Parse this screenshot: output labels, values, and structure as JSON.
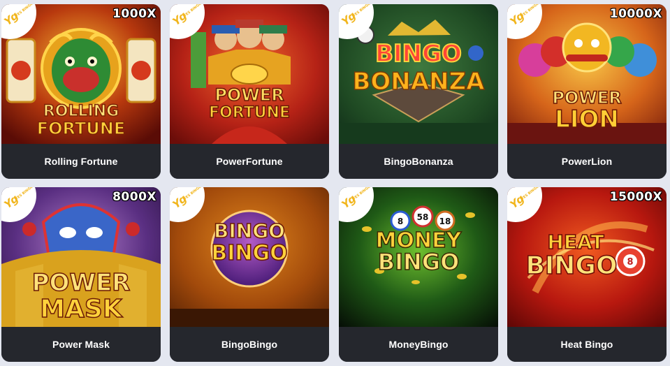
{
  "provider_badge": {
    "logo": "Yg",
    "sub": "YES BINGO",
    "icon": "provider-logo-icon"
  },
  "games": [
    {
      "title": "Rolling Fortune",
      "art_logo_line1": "ROLLING",
      "art_logo_line2": "FORTUNE",
      "multiplier": "1000X"
    },
    {
      "title": "PowerFortune",
      "art_logo_line1": "POWER",
      "art_logo_line2": "FORTUNE",
      "multiplier": ""
    },
    {
      "title": "BingoBonanza",
      "art_logo_line1": "BINGO",
      "art_logo_line2": "BONANZA",
      "multiplier": ""
    },
    {
      "title": "PowerLion",
      "art_logo_line1": "POWER",
      "art_logo_line2": "LION",
      "multiplier": "10000X"
    },
    {
      "title": "Power Mask",
      "art_logo_line1": "POWER",
      "art_logo_line2": "MASK",
      "multiplier": "8000X"
    },
    {
      "title": "BingoBingo",
      "art_logo_line1": "BINGO",
      "art_logo_line2": "BINGO",
      "multiplier": ""
    },
    {
      "title": "MoneyBingo",
      "art_logo_line1": "MONEY",
      "art_logo_line2": "BINGO",
      "art_balls": [
        "8",
        "58",
        "18"
      ],
      "multiplier": ""
    },
    {
      "title": "Heat Bingo",
      "art_logo_line1": "HEAT",
      "art_logo_line2": "BINGO",
      "art_ball": "8",
      "multiplier": "15000X"
    }
  ]
}
